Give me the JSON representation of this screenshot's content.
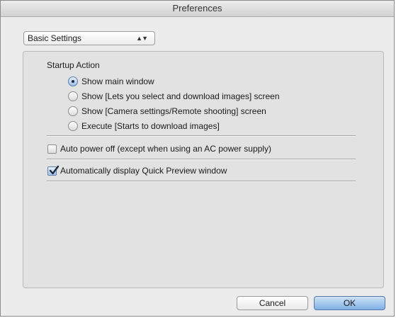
{
  "window": {
    "title": "Preferences"
  },
  "popup": {
    "selected": "Basic Settings"
  },
  "startup": {
    "heading": "Startup Action",
    "options": [
      {
        "label": "Show main window",
        "selected": true
      },
      {
        "label": "Show [Lets you select and download images] screen",
        "selected": false
      },
      {
        "label": "Show [Camera settings/Remote shooting] screen",
        "selected": false
      },
      {
        "label": "Execute [Starts to download images]",
        "selected": false
      }
    ]
  },
  "checkboxes": {
    "auto_power_off": {
      "label": "Auto power off (except when using an AC power supply)",
      "checked": false
    },
    "quick_preview": {
      "label": "Automatically display Quick Preview window",
      "checked": true
    }
  },
  "buttons": {
    "cancel": "Cancel",
    "ok": "OK"
  },
  "colors": {
    "window_bg": "#ececec",
    "group_bg": "#e2e2e2",
    "default_button": "#7fb0e4"
  }
}
